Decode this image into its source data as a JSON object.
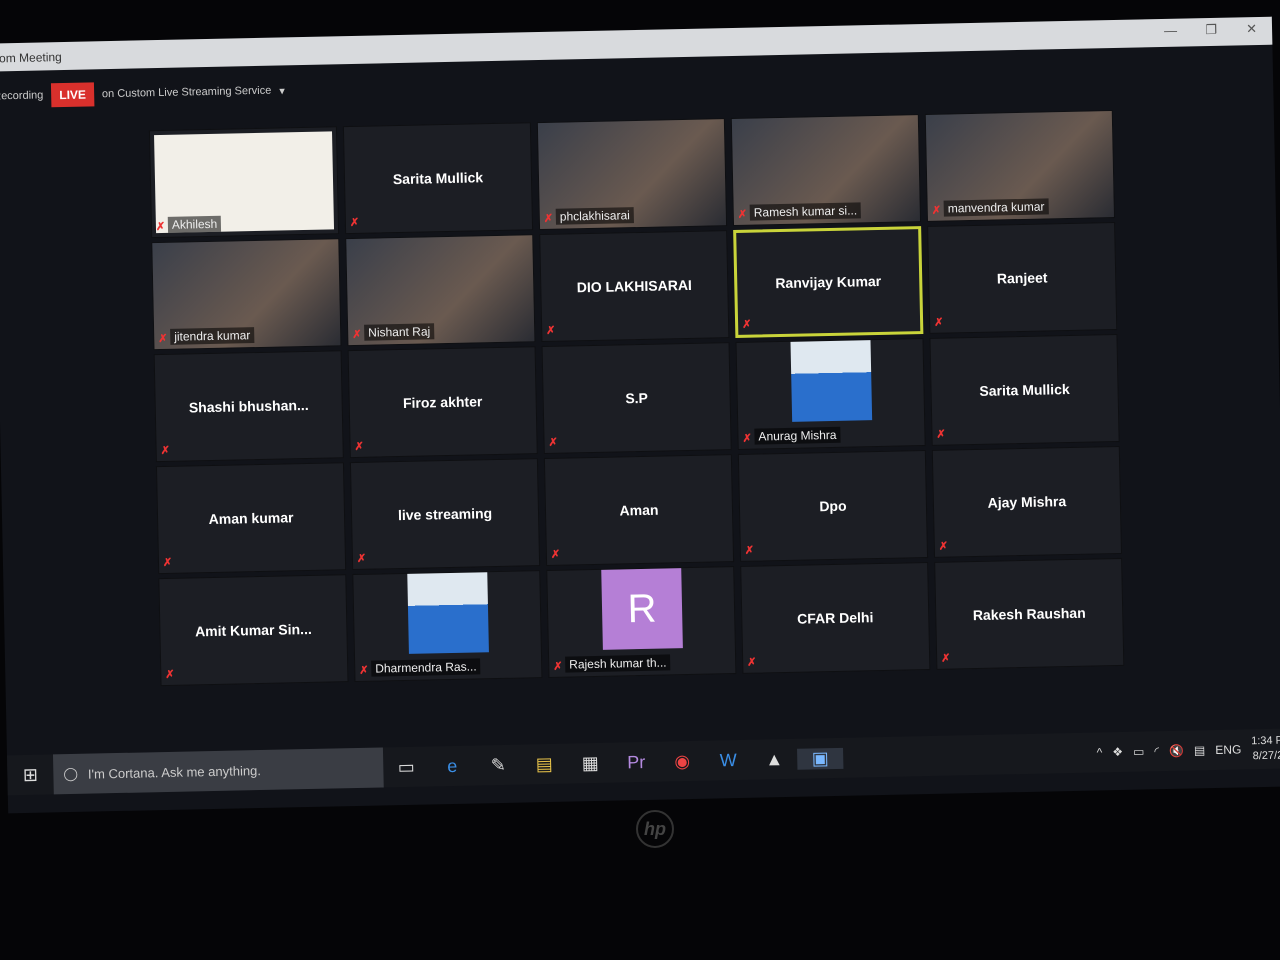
{
  "window": {
    "title": "oom Meeting"
  },
  "recording": {
    "recording_label": "Recording",
    "live_badge": "LIVE",
    "stream_label": "on Custom Live Streaming Service"
  },
  "colors": {
    "live": "#d9302c",
    "active_speaker_border": "#c9d43a",
    "muted_icon": "#e33333"
  },
  "tiles": [
    {
      "name": "Akhilesh",
      "kind": "slide"
    },
    {
      "name": "Sarita Mullick",
      "kind": "name"
    },
    {
      "name": "phclakhisarai",
      "kind": "video"
    },
    {
      "name": "Ramesh kumar si...",
      "kind": "video"
    },
    {
      "name": "manvendra kumar",
      "kind": "video"
    },
    {
      "name": "jitendra kumar",
      "kind": "video"
    },
    {
      "name": "Nishant Raj",
      "kind": "video"
    },
    {
      "name": "DIO LAKHISARAI",
      "kind": "name"
    },
    {
      "name": "Ranvijay Kumar",
      "kind": "name",
      "active": true
    },
    {
      "name": "Ranjeet",
      "kind": "name"
    },
    {
      "name": "Shashi  bhushan...",
      "kind": "name"
    },
    {
      "name": "Firoz akhter",
      "kind": "name"
    },
    {
      "name": "S.P",
      "kind": "name"
    },
    {
      "name": "Anurag Mishra",
      "kind": "photo"
    },
    {
      "name": "Sarita Mullick",
      "kind": "name"
    },
    {
      "name": "Aman kumar",
      "kind": "name"
    },
    {
      "name": "live streaming",
      "kind": "name"
    },
    {
      "name": "Aman",
      "kind": "name"
    },
    {
      "name": "Dpo",
      "kind": "name"
    },
    {
      "name": "Ajay Mishra",
      "kind": "name"
    },
    {
      "name": "Amit Kumar Sin...",
      "kind": "name"
    },
    {
      "name": "Dharmendra Ras...",
      "kind": "photo"
    },
    {
      "name": "Rajesh kumar th...",
      "kind": "avatar",
      "letter": "R"
    },
    {
      "name": "CFAR Delhi",
      "kind": "name"
    },
    {
      "name": "Rakesh Raushan",
      "kind": "name"
    }
  ],
  "taskbar": {
    "cortana_placeholder": "I'm Cortana. Ask me anything.",
    "language": "ENG",
    "time": "1:34 P",
    "date": "8/27/2",
    "apps": [
      "task-view",
      "edge",
      "paint",
      "file-explorer",
      "store",
      "premiere",
      "chrome",
      "word",
      "photos",
      "zoom"
    ]
  },
  "bezel": {
    "logo": "hp"
  }
}
